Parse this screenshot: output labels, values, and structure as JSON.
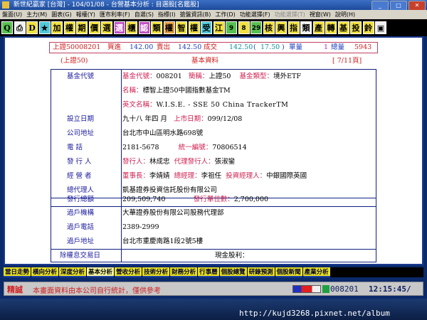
{
  "window": {
    "title": "新世紀贏家 [台灣] - 104/01/08 - 台營基本分析 : 目選股[名鑑股]",
    "min": "_",
    "max": "□",
    "close": "✕"
  },
  "menu": [
    "盤面(U)",
    "主力(M)",
    "圖表(G)",
    "報權(Y)",
    "匯市利率(F)",
    "自選(S)",
    "指標(I)",
    "搶盤資訊(B)",
    "工作(D)",
    "功能選擇(F)",
    "功能選擇(T)",
    "視窗(W)",
    "說明(H)"
  ],
  "toolbar": {
    "buttons": [
      {
        "t": "Q",
        "c": "g"
      },
      {
        "t": "⎙",
        "c": "w"
      },
      {
        "t": "D",
        "c": "y"
      },
      {
        "t": "★",
        "c": "c"
      },
      {
        "t": "加",
        "c": "y"
      },
      {
        "t": "權",
        "c": "y"
      },
      {
        "t": "期",
        "c": "y"
      },
      {
        "t": "價",
        "c": "y"
      },
      {
        "t": "選",
        "c": "y"
      },
      {
        "t": "選",
        "c": "p"
      },
      {
        "t": "櫃",
        "c": "y"
      },
      {
        "t": "認",
        "c": "p"
      },
      {
        "t": "類",
        "c": "y"
      },
      {
        "t": "權",
        "c": "o"
      },
      {
        "t": "智",
        "c": "y"
      },
      {
        "t": "權",
        "c": "y"
      },
      {
        "t": "受",
        "c": "c"
      },
      {
        "t": "江",
        "c": "y"
      },
      {
        "t": "9",
        "c": "g"
      },
      {
        "t": "8",
        "c": "y"
      },
      {
        "t": "29",
        "c": "g"
      },
      {
        "t": "核",
        "c": "y"
      },
      {
        "t": "興",
        "c": "y"
      },
      {
        "t": "指",
        "c": "y"
      },
      {
        "t": "類",
        "c": "w"
      },
      {
        "t": "產",
        "c": "y"
      },
      {
        "t": "轉",
        "c": "y"
      },
      {
        "t": "基",
        "c": "y"
      },
      {
        "t": "投",
        "c": "y"
      },
      {
        "t": "鈴",
        "c": "y"
      },
      {
        "t": "▣",
        "c": "w"
      }
    ]
  },
  "quote": {
    "symbol": "上證50008201",
    "buy_label": "買進",
    "buy": "142.00",
    "sell_label": "賣出",
    "sell": "142.50",
    "deal_label": "成交",
    "deal": "142.50",
    "change": "17.50",
    "vol_label": "單量",
    "vol": "1",
    "total_label": "總量",
    "total": "5943"
  },
  "page": {
    "short_name": "(上證50)",
    "section": "基本資料",
    "page_indicator": "[ 7/11頁]"
  },
  "info": {
    "code": {
      "label": "基金代號",
      "k1": "基金代號：",
      "v1": "008201",
      "k2": "簡稱：",
      "v2": "上證50",
      "k3": "基金類型：",
      "v3": "境外ETF"
    },
    "name_row": {
      "k": "名稱：",
      "v": "標智上證50中國指數基金TM"
    },
    "eng_row": {
      "k": "英文名稱：",
      "v": "W.I.S.E. - SSE 50 China TrackerTM"
    },
    "setup": {
      "label": "設立日期",
      "v": "九十八  年四  月",
      "k2": "上市日期：",
      "v2": "099/12/08"
    },
    "addr": {
      "label": "公司地址",
      "v": "台北市中山區明水路698號"
    },
    "phone": {
      "label": "電    話",
      "v": "2181-5678",
      "k2": "統一編號：",
      "v2": "70806514"
    },
    "issuer": {
      "label": "發 行 人",
      "k": "發行人：",
      "v": "林成忠",
      "k2": "代理發行人：",
      "v2": "張淑鑾"
    },
    "manager": {
      "label": "經 營 者",
      "k": "董事長：",
      "v": "李婧婧",
      "k2": "總經理：",
      "v2": "李祖任",
      "k3": "投資經理人：",
      "v3": "中銀國際英國"
    },
    "agent": {
      "label": "總代理人",
      "v": "凱基證券投資信託股份有限公司"
    },
    "issued": {
      "label": "發行總額",
      "v": "209,509,740",
      "k2": "發行單位數：",
      "v2": "2,700,000"
    },
    "transfer": {
      "label": "過戶機構",
      "v": "大華證券股份有限公司股務代理部"
    },
    "transfer_phone": {
      "label": "過戶電話",
      "v": "2389-2999"
    },
    "transfer_addr": {
      "label": "過戶地址",
      "v": "台北市重慶南路1段2號5樓"
    },
    "ex_date": {
      "label": "除權息交易日",
      "k": "現金股利："
    }
  },
  "tabs": [
    "當日走勢",
    "橫向分析",
    "深度分析",
    "基本分析",
    "營收分析",
    "技術分析",
    "財務分析",
    "行事曆",
    "個股總覽",
    "研錄預測",
    "個股新聞",
    "產業分析"
  ],
  "active_tab": "基本分析",
  "status": {
    "tag": "精誠",
    "message": "本畫面資料由本公司自行統計，僅供參考",
    "code": "008201",
    "time": "12:15:45/"
  },
  "watermark": "http://kujd3268.pixnet.net/album"
}
